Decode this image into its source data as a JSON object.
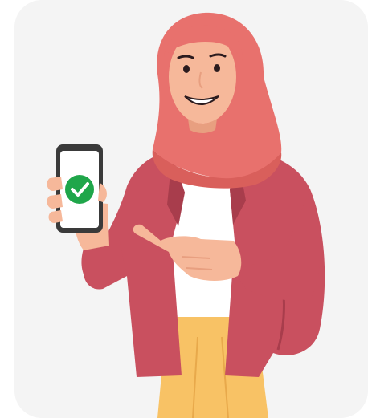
{
  "illustration": {
    "subject": "woman-in-hijab-holding-phone",
    "status_icon": "check-circle-icon"
  },
  "colors": {
    "card_bg": "#f4f4f4",
    "hijab": "#e8716d",
    "hijab_shade": "#d95f5b",
    "skin": "#f6b89a",
    "skin_shade": "#e89f80",
    "jacket": "#c9505f",
    "jacket_shade": "#a83d4c",
    "shirt": "#ffffff",
    "skirt": "#f8c265",
    "skirt_shade": "#e8a94b",
    "phone_frame": "#3a3a3a",
    "phone_screen": "#ffffff",
    "check_green": "#1fa64a",
    "outline": "#2b1b1e"
  }
}
